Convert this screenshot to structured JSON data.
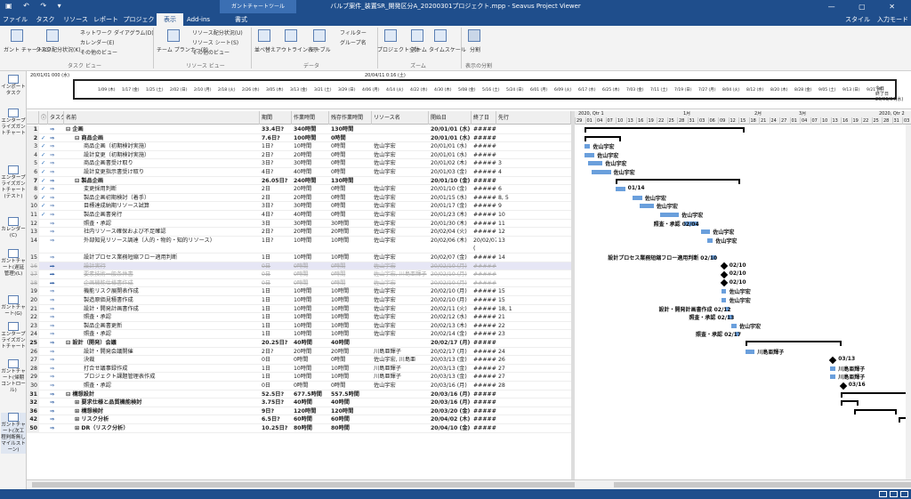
{
  "titlebar": {
    "title": "バルブ案件_装置SR_開発区分A_20200301プロジェクト.mpp - Seavus Project Viewer",
    "context_group": "ガントチャートツール"
  },
  "tabs": [
    {
      "label": "ファイル"
    },
    {
      "label": "タスク"
    },
    {
      "label": "リソース"
    },
    {
      "label": "レポート"
    },
    {
      "label": "プロジェクト"
    },
    {
      "label": "表示",
      "active": true
    },
    {
      "label": "Add-ins"
    },
    {
      "label": "書式"
    }
  ],
  "tabs_right": {
    "style": "スタイル",
    "input_mode": "入力モード"
  },
  "ribbon": {
    "gantt_chart": "ガント チャート(G)",
    "task_usage": "タスク配分状況(K)",
    "network": "ネットワーク ダイアグラム(D)",
    "calendar": "カレンダー(E)",
    "other_views": "その他のビュー",
    "group_task_view": "タスク ビュー",
    "team_planner": "チーム プランナー(P)",
    "resource_usage": "リソース配分状況(U)",
    "resource_sheet": "リソース シート(S)",
    "other_views2": "その他のビュー",
    "group_resource_view": "リソース ビュー",
    "sort": "並べ替え",
    "outline": "アウトライン表示",
    "table": "テーブル",
    "filter": "フィルター",
    "group": "グループ名",
    "group_data": "データ",
    "entire_project": "プロジェクト全体",
    "zoom": "ズーム",
    "timescale": "タイムスケール",
    "group_zoom": "ズーム",
    "split": "分割",
    "group_split": "表示の分割"
  },
  "sidebar": [
    {
      "label": "インポートタスク",
      "icon": "import-icon"
    },
    {
      "label": "エンタープライズガントチャート",
      "icon": "gantt-icon"
    },
    {
      "label": "エンタープライズガントチャート(テスト)",
      "icon": "gantt-icon"
    },
    {
      "label": "カレンダー(C)",
      "icon": "calendar-icon"
    },
    {
      "label": "ガントチャート(遅延管理)(L)",
      "icon": "gantt-icon"
    },
    {
      "label": "ガントチャート(G)",
      "icon": "gantt-icon"
    },
    {
      "label": "エンタープライズガントチャート",
      "icon": "gantt-icon"
    },
    {
      "label": "ガントチャート(帰期コントロール)",
      "icon": "gantt-icon"
    },
    {
      "label": "ガントチャート(次工程判断無しマイルストーン)",
      "icon": "gantt-icon"
    }
  ],
  "timeline": {
    "start": "20/01/01 000 (水)",
    "end": "20/04/11 0:16 (土)",
    "today": "今日",
    "finish_label": "終了日",
    "finish_value": "20/06/04(水)",
    "ticks": [
      "1/09 (木)",
      "1/17 (金)",
      "1/25 (土)",
      "2/02 (日)",
      "2/10 (月)",
      "2/18 (火)",
      "2/26 (水)",
      "3/05 (木)",
      "3/13 (金)",
      "3/21 (土)",
      "3/29 (日)",
      "4/06 (月)",
      "4/14 (火)",
      "4/22 (水)",
      "4/30 (木)",
      "5/08 (金)",
      "5/16 (土)",
      "5/24 (日)",
      "6/01 (月)",
      "6/09 (火)",
      "6/17 (水)",
      "6/25 (木)",
      "7/03 (金)",
      "7/11 (土)",
      "7/19 (日)",
      "7/27 (月)",
      "8/04 (火)",
      "8/12 (水)",
      "8/20 (木)",
      "8/28 (金)",
      "9/05 (土)",
      "9/13 (日)",
      "9/21 (月)"
    ]
  },
  "grid": {
    "headers": [
      "",
      "ⓘ",
      "タスクモード",
      "名前",
      "期間",
      "作業時間",
      "残存作業時間",
      "リソース名",
      "開始日",
      "終了日",
      "先行"
    ],
    "rows": [
      {
        "id": "1",
        "check": "",
        "name": "⊟ 企画",
        "indent": 0,
        "dur": "33.4日?",
        "work": "340時間",
        "rem": "130時間",
        "res": "",
        "start": "20/01/01 (水)",
        "fin": "#########",
        "pred": "",
        "summary": true
      },
      {
        "id": "2",
        "check": "✓",
        "name": "⊟ 商品企画",
        "indent": 1,
        "dur": "7.6日?",
        "work": "100時間",
        "rem": "0時間",
        "res": "",
        "start": "20/01/01 (水)",
        "fin": "#########",
        "pred": "",
        "summary": true
      },
      {
        "id": "3",
        "check": "✓",
        "name": "商品企画（初期検討実施）",
        "indent": 2,
        "dur": "1日?",
        "work": "10時間",
        "rem": "0時間",
        "res": "佐山宇宏",
        "start": "20/01/01 (水)",
        "fin": "#########",
        "pred": ""
      },
      {
        "id": "4",
        "check": "✓",
        "name": "設計変更（初期検討実施）",
        "indent": 2,
        "dur": "2日?",
        "work": "20時間",
        "rem": "0時間",
        "res": "佐山宇宏",
        "start": "20/01/01 (水)",
        "fin": "#########",
        "pred": ""
      },
      {
        "id": "5",
        "check": "✓",
        "name": "商品企画書受け取り",
        "indent": 2,
        "dur": "3日?",
        "work": "30時間",
        "rem": "0時間",
        "res": "佐山宇宏",
        "start": "20/01/02 (木)",
        "fin": "#########",
        "pred": "3"
      },
      {
        "id": "6",
        "check": "✓",
        "name": "設計変更指示書受け取り",
        "indent": 2,
        "dur": "4日?",
        "work": "40時間",
        "rem": "0時間",
        "res": "佐山宇宏",
        "start": "20/01/03 (金)",
        "fin": "#########",
        "pred": "4"
      },
      {
        "id": "7",
        "check": "✓",
        "name": "⊟ 製品企画",
        "indent": 1,
        "dur": "26.05日?",
        "work": "240時間",
        "rem": "130時間",
        "res": "",
        "start": "20/01/10 (金)",
        "fin": "#########",
        "pred": "",
        "summary": true
      },
      {
        "id": "8",
        "check": "✓",
        "name": "変更採用判断",
        "indent": 2,
        "dur": "2日",
        "work": "20時間",
        "rem": "0時間",
        "res": "佐山宇宏",
        "start": "20/01/10 (金)",
        "fin": "#########",
        "pred": "6"
      },
      {
        "id": "9",
        "check": "✓",
        "name": "製品企画初期検討（着手）",
        "indent": 2,
        "dur": "2日",
        "work": "20時間",
        "rem": "0時間",
        "res": "佐山宇宏",
        "start": "20/01/15 (水)",
        "fin": "#########",
        "pred": "8, 5"
      },
      {
        "id": "10",
        "check": "✓",
        "name": "目標達成納期リソース試算",
        "indent": 2,
        "dur": "3日?",
        "work": "30時間",
        "rem": "0時間",
        "res": "佐山宇宏",
        "start": "20/01/17 (金)",
        "fin": "#########",
        "pred": "9"
      },
      {
        "id": "11",
        "check": "✓",
        "name": "製品企画書発行",
        "indent": 2,
        "dur": "4日?",
        "work": "40時間",
        "rem": "0時間",
        "res": "佐山宇宏",
        "start": "20/01/23 (木)",
        "fin": "#########",
        "pred": "10"
      },
      {
        "id": "12",
        "check": "",
        "name": "照査・承認",
        "indent": 2,
        "dur": "3日",
        "work": "30時間",
        "rem": "30時間",
        "res": "佐山宇宏",
        "start": "20/01/30 (木)",
        "fin": "#########",
        "pred": "11"
      },
      {
        "id": "13",
        "check": "",
        "name": "社内リソース確保および不足確認",
        "indent": 2,
        "dur": "2日?",
        "work": "20時間",
        "rem": "20時間",
        "res": "佐山宇宏",
        "start": "20/02/04 (火)",
        "fin": "#########",
        "pred": "12"
      },
      {
        "id": "14",
        "check": "",
        "name": "外部知見リソース調達（人的・物的・知的リソース）",
        "indent": 2,
        "dur": "1日?",
        "work": "10時間",
        "rem": "10時間",
        "res": "佐山宇宏",
        "start": "20/02/06 (木)",
        "fin": "20/02/07 (",
        "pred": "13",
        "tall": true
      },
      {
        "id": "15",
        "check": "",
        "name": "設計プロセス業務短縮フロー適用判断",
        "indent": 2,
        "dur": "1日",
        "work": "10時間",
        "rem": "10時間",
        "res": "佐山宇宏",
        "start": "20/02/07 (金)",
        "fin": "#########",
        "pred": "14"
      },
      {
        "id": "16",
        "check": "",
        "name": "設計実行",
        "indent": 2,
        "dur": "0日",
        "work": "0時間",
        "rem": "0時間",
        "res": "佐山宇宏",
        "start": "20/02/10 (月)",
        "fin": "#########",
        "pred": "",
        "strike": true,
        "sel": true
      },
      {
        "id": "17",
        "check": "",
        "name": "要素技術一般条件書",
        "indent": 2,
        "dur": "0日",
        "work": "0時間",
        "rem": "0時間",
        "res": "佐山宇宏, 川島亜輝子",
        "start": "20/02/10 (月)",
        "fin": "#########",
        "pred": "",
        "strike": true
      },
      {
        "id": "18",
        "check": "",
        "name": "企画機能仕様書作成",
        "indent": 2,
        "dur": "0日",
        "work": "0時間",
        "rem": "0時間",
        "res": "佐山宇宏",
        "start": "20/02/10 (月)",
        "fin": "#########",
        "pred": "",
        "strike": true
      },
      {
        "id": "19",
        "check": "",
        "name": "機能リスク展開表作成",
        "indent": 2,
        "dur": "1日",
        "work": "10時間",
        "rem": "10時間",
        "res": "佐山宇宏",
        "start": "20/02/10 (月)",
        "fin": "#########",
        "pred": "15"
      },
      {
        "id": "20",
        "check": "",
        "name": "製造原価見積書作成",
        "indent": 2,
        "dur": "1日",
        "work": "10時間",
        "rem": "10時間",
        "res": "佐山宇宏",
        "start": "20/02/10 (月)",
        "fin": "#########",
        "pred": "15"
      },
      {
        "id": "21",
        "check": "",
        "name": "設計・開発計画書作成",
        "indent": 2,
        "dur": "1日",
        "work": "10時間",
        "rem": "10時間",
        "res": "佐山宇宏",
        "start": "20/02/11 (火)",
        "fin": "#########",
        "pred": "18, 1"
      },
      {
        "id": "22",
        "check": "",
        "name": "照査・承認",
        "indent": 2,
        "dur": "1日",
        "work": "10時間",
        "rem": "10時間",
        "res": "佐山宇宏",
        "start": "20/02/12 (水)",
        "fin": "#########",
        "pred": "21"
      },
      {
        "id": "23",
        "check": "",
        "name": "製品企画書更新",
        "indent": 2,
        "dur": "1日",
        "work": "10時間",
        "rem": "10時間",
        "res": "佐山宇宏",
        "start": "20/02/13 (木)",
        "fin": "#########",
        "pred": "22"
      },
      {
        "id": "24",
        "check": "",
        "name": "照査・承認",
        "indent": 2,
        "dur": "1日",
        "work": "10時間",
        "rem": "10時間",
        "res": "佐山宇宏",
        "start": "20/02/14 (金)",
        "fin": "#########",
        "pred": "23"
      },
      {
        "id": "25",
        "check": "",
        "name": "⊟ 設計（開発）会議",
        "indent": 0,
        "dur": "20.25日?",
        "work": "40時間",
        "rem": "40時間",
        "res": "",
        "start": "20/02/17 (月)",
        "fin": "#########",
        "pred": "",
        "summary": true
      },
      {
        "id": "26",
        "check": "",
        "name": "設計・開発会議開催",
        "indent": 2,
        "dur": "2日?",
        "work": "20時間",
        "rem": "20時間",
        "res": "川島亜輝子",
        "start": "20/02/17 (月)",
        "fin": "#########",
        "pred": "24"
      },
      {
        "id": "27",
        "check": "",
        "name": "決裁",
        "indent": 2,
        "dur": "0日",
        "work": "0時間",
        "rem": "0時間",
        "res": "佐山宇宏, 川島亜",
        "start": "20/03/13 (金)",
        "fin": "#########",
        "pred": "26"
      },
      {
        "id": "28",
        "check": "",
        "name": "打合せ議事録作成",
        "indent": 2,
        "dur": "1日",
        "work": "10時間",
        "rem": "10時間",
        "res": "川島亜輝子",
        "start": "20/03/13 (金)",
        "fin": "#########",
        "pred": "27"
      },
      {
        "id": "29",
        "check": "",
        "name": "プロジェクト課題管理表作成",
        "indent": 2,
        "dur": "1日",
        "work": "10時間",
        "rem": "10時間",
        "res": "川島亜輝子",
        "start": "20/03/13 (金)",
        "fin": "#########",
        "pred": "27"
      },
      {
        "id": "30",
        "check": "",
        "name": "照査・承認",
        "indent": 2,
        "dur": "0日",
        "work": "0時間",
        "rem": "0時間",
        "res": "佐山宇宏",
        "start": "20/03/16 (月)",
        "fin": "#########",
        "pred": "28"
      },
      {
        "id": "31",
        "check": "",
        "name": "⊟ 構想設計",
        "indent": 0,
        "dur": "52.5日?",
        "work": "677.5時間",
        "rem": "557.5時間",
        "res": "",
        "start": "20/03/16 (月)",
        "fin": "#########",
        "pred": "",
        "summary": true
      },
      {
        "id": "32",
        "check": "",
        "name": "⊞ 要求仕様と品質機能検討",
        "indent": 1,
        "dur": "3.75日?",
        "work": "40時間",
        "rem": "40時間",
        "res": "",
        "start": "20/03/16 (月)",
        "fin": "#########",
        "pred": "",
        "summary": true
      },
      {
        "id": "36",
        "check": "",
        "name": "⊞ 構想検討",
        "indent": 1,
        "dur": "9日?",
        "work": "120時間",
        "rem": "120時間",
        "res": "",
        "start": "20/03/20 (金)",
        "fin": "#########",
        "pred": "",
        "summary": true
      },
      {
        "id": "42",
        "check": "",
        "name": "⊞ リスク分析",
        "indent": 1,
        "dur": "6.5日?",
        "work": "60時間",
        "rem": "60時間",
        "res": "",
        "start": "20/04/02 (木)",
        "fin": "#########",
        "pred": "",
        "summary": true
      },
      {
        "id": "50",
        "check": "",
        "name": "⊞ DR（リスク分析）",
        "indent": 1,
        "dur": "10.25日?",
        "work": "80時間",
        "rem": "80時間",
        "res": "",
        "start": "20/04/10 (金)",
        "fin": "#########",
        "pred": "",
        "summary": true
      }
    ]
  },
  "gantt": {
    "header_top": [
      "2020, Qtr 1",
      "1月",
      "2月",
      "3月",
      "2020, Qtr 2"
    ],
    "days": [
      "29",
      "01",
      "04",
      "07",
      "10",
      "13",
      "16",
      "19",
      "22",
      "25",
      "28",
      "31",
      "03",
      "06",
      "09",
      "12",
      "15",
      "18",
      "21",
      "24",
      "27",
      "01",
      "04",
      "07",
      "10",
      "13",
      "16",
      "19",
      "22",
      "25",
      "28",
      "31",
      "03"
    ],
    "labels": [
      {
        "row": 3,
        "text": "佐山宇宏"
      },
      {
        "row": 4,
        "text": "佐山宇宏"
      },
      {
        "row": 5,
        "text": "佐山宇宏"
      },
      {
        "row": 6,
        "text": "佐山宇宏"
      },
      {
        "row": 8,
        "text": "01/14"
      },
      {
        "row": 9,
        "text": "佐山宇宏"
      },
      {
        "row": 10,
        "text": "佐山宇宏"
      },
      {
        "row": 11,
        "text": "佐山宇宏"
      },
      {
        "row": 12,
        "text": "照査・承認 02/04"
      },
      {
        "row": 13,
        "text": "佐山宇宏"
      },
      {
        "row": 14,
        "text": "佐山宇宏"
      },
      {
        "row": 15,
        "text": "設計プロセス業務短縮フロー適用判断 02/10"
      },
      {
        "row": 16,
        "text": "02/10"
      },
      {
        "row": 17,
        "text": "02/10"
      },
      {
        "row": 18,
        "text": "02/10"
      },
      {
        "row": 19,
        "text": "佐山宇宏"
      },
      {
        "row": 20,
        "text": "佐山宇宏"
      },
      {
        "row": 21,
        "text": "設計・開発計画書作成 02/12"
      },
      {
        "row": 22,
        "text": "照査・承認 02/13"
      },
      {
        "row": 23,
        "text": "佐山宇宏"
      },
      {
        "row": 24,
        "text": "照査・承認 02/17"
      },
      {
        "row": 26,
        "text": "川島亜輝子"
      },
      {
        "row": 27,
        "text": "03/13"
      },
      {
        "row": 28,
        "text": "川島亜輝子"
      },
      {
        "row": 29,
        "text": "川島亜輝子"
      },
      {
        "row": 30,
        "text": "03/16"
      }
    ]
  }
}
